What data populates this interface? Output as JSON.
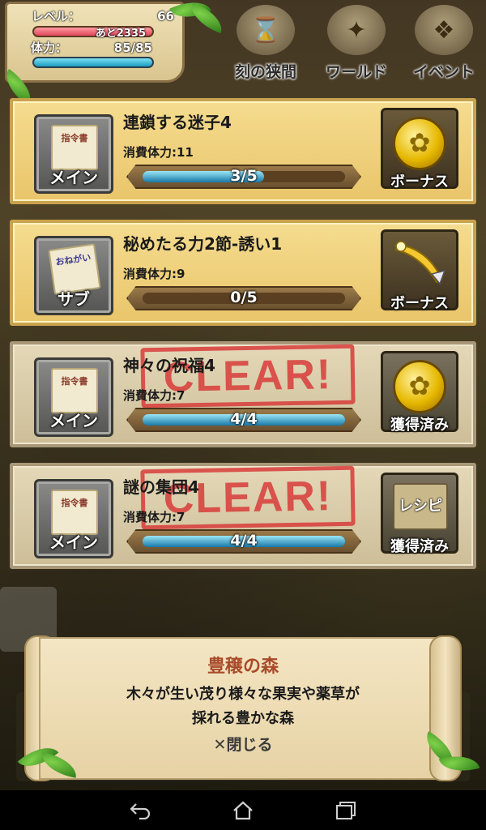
{
  "status": {
    "level_label": "レベル：",
    "level_value": "66",
    "exp_label": "あと2335",
    "stamina_label": "体力：",
    "stamina_value": "85/85"
  },
  "topnav": [
    {
      "label": "刻の狭間",
      "icon": "hourglass-icon"
    },
    {
      "label": "ワールド",
      "icon": "world-crest-icon"
    },
    {
      "label": "イベント",
      "icon": "event-crest-icon"
    }
  ],
  "quests": [
    {
      "title": "連鎖する迷子4",
      "type": "メイン",
      "cost": "消費体力:11",
      "progress_text": "3/5",
      "progress": 0.6,
      "reward_label": "ボーナス",
      "reward_icon": "gold-coin-icon",
      "cleared": false
    },
    {
      "title": "秘めたる力2節-誘い1",
      "type": "サブ",
      "cost": "消費体力:9",
      "progress_text": "0/5",
      "progress": 0.0,
      "reward_label": "ボーナス",
      "reward_icon": "feather-icon",
      "cleared": false
    },
    {
      "title": "神々の祝福4",
      "type": "メイン",
      "cost": "消費体力:7",
      "progress_text": "4/4",
      "progress": 1.0,
      "reward_label": "獲得済み",
      "reward_icon": "gold-coin-icon",
      "cleared": true
    },
    {
      "title": "謎の集団4",
      "type": "メイン",
      "cost": "消費体力:7",
      "progress_text": "4/4",
      "progress": 1.0,
      "reward_label": "獲得済み",
      "reward_icon": "recipe-icon",
      "cleared": true
    }
  ],
  "icon_paper_text": {
    "main": "指令書",
    "sub": "おねがい"
  },
  "recipe_text": "レシピ",
  "clear_stamp": "CLEAR!",
  "dialog": {
    "title": "豊穣の森",
    "line1": "木々が生い茂り様々な果実や薬草が",
    "line2": "採れる豊かな森",
    "close_label": "✕閉じる"
  },
  "navbar": {
    "back": "back-icon",
    "home": "home-icon",
    "recents": "recents-icon"
  },
  "colors": {
    "accent_red": "#d73232",
    "card_gold": "#e9c56a",
    "progress_blue": "#1878a8",
    "dialog_title": "#a84a2a"
  }
}
